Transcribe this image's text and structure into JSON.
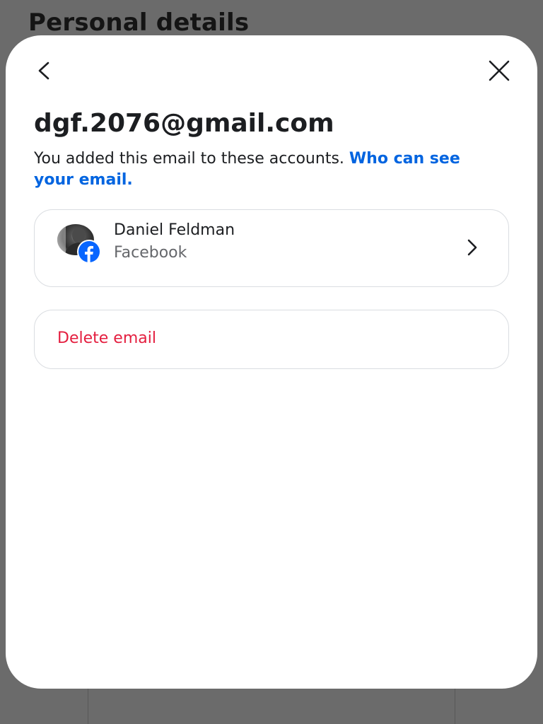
{
  "background": {
    "page_title": "Personal details"
  },
  "sheet": {
    "title": "dgf.2076@gmail.com",
    "description_text": "You added this email to these accounts. ",
    "description_link": "Who can see your email.",
    "accounts": [
      {
        "name": "Daniel Feldman",
        "platform": "Facebook"
      }
    ],
    "delete_label": "Delete email"
  },
  "icons": {
    "back": "back-arrow-icon",
    "close": "close-icon",
    "platform": "facebook-icon",
    "chevron": "chevron-right-icon"
  },
  "colors": {
    "link": "#0064e0",
    "danger": "#e41e3f",
    "facebook": "#0866ff"
  }
}
